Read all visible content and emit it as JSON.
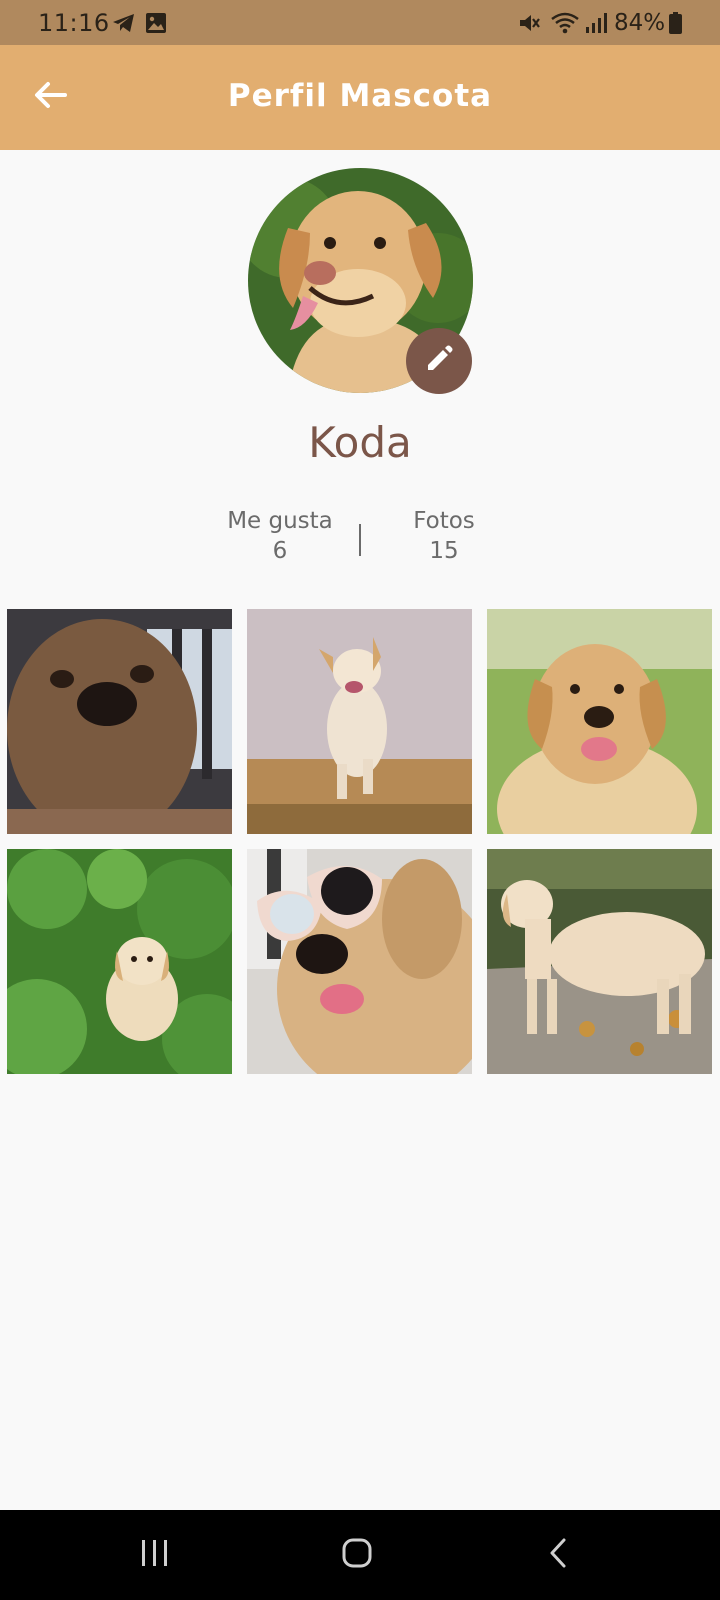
{
  "status_bar": {
    "time": "11:16",
    "battery_percent": "84%",
    "icons": [
      "telegram-icon",
      "gallery-icon",
      "mute-icon",
      "wifi-icon",
      "signal-icon",
      "battery-icon"
    ]
  },
  "app_bar": {
    "title": "Perfil Mascota",
    "back_icon": "arrow-back-icon",
    "background_color": "#e2ae70"
  },
  "profile": {
    "name": "Koda",
    "edit_icon": "pencil-icon",
    "accent_color": "#7b5649"
  },
  "stats": {
    "likes_label": "Me gusta",
    "likes_value": "6",
    "photos_label": "Fotos",
    "photos_value": "15"
  },
  "photos": [
    {
      "subject": "dog-closeup-nose"
    },
    {
      "subject": "dog-running-field"
    },
    {
      "subject": "golden-retriever-portrait"
    },
    {
      "subject": "puppy-in-grass"
    },
    {
      "subject": "dog-with-sunglasses"
    },
    {
      "subject": "golden-retriever-standing-path"
    }
  ],
  "nav_bar": {
    "icons": [
      "recent-apps-icon",
      "home-icon",
      "back-nav-icon"
    ]
  }
}
